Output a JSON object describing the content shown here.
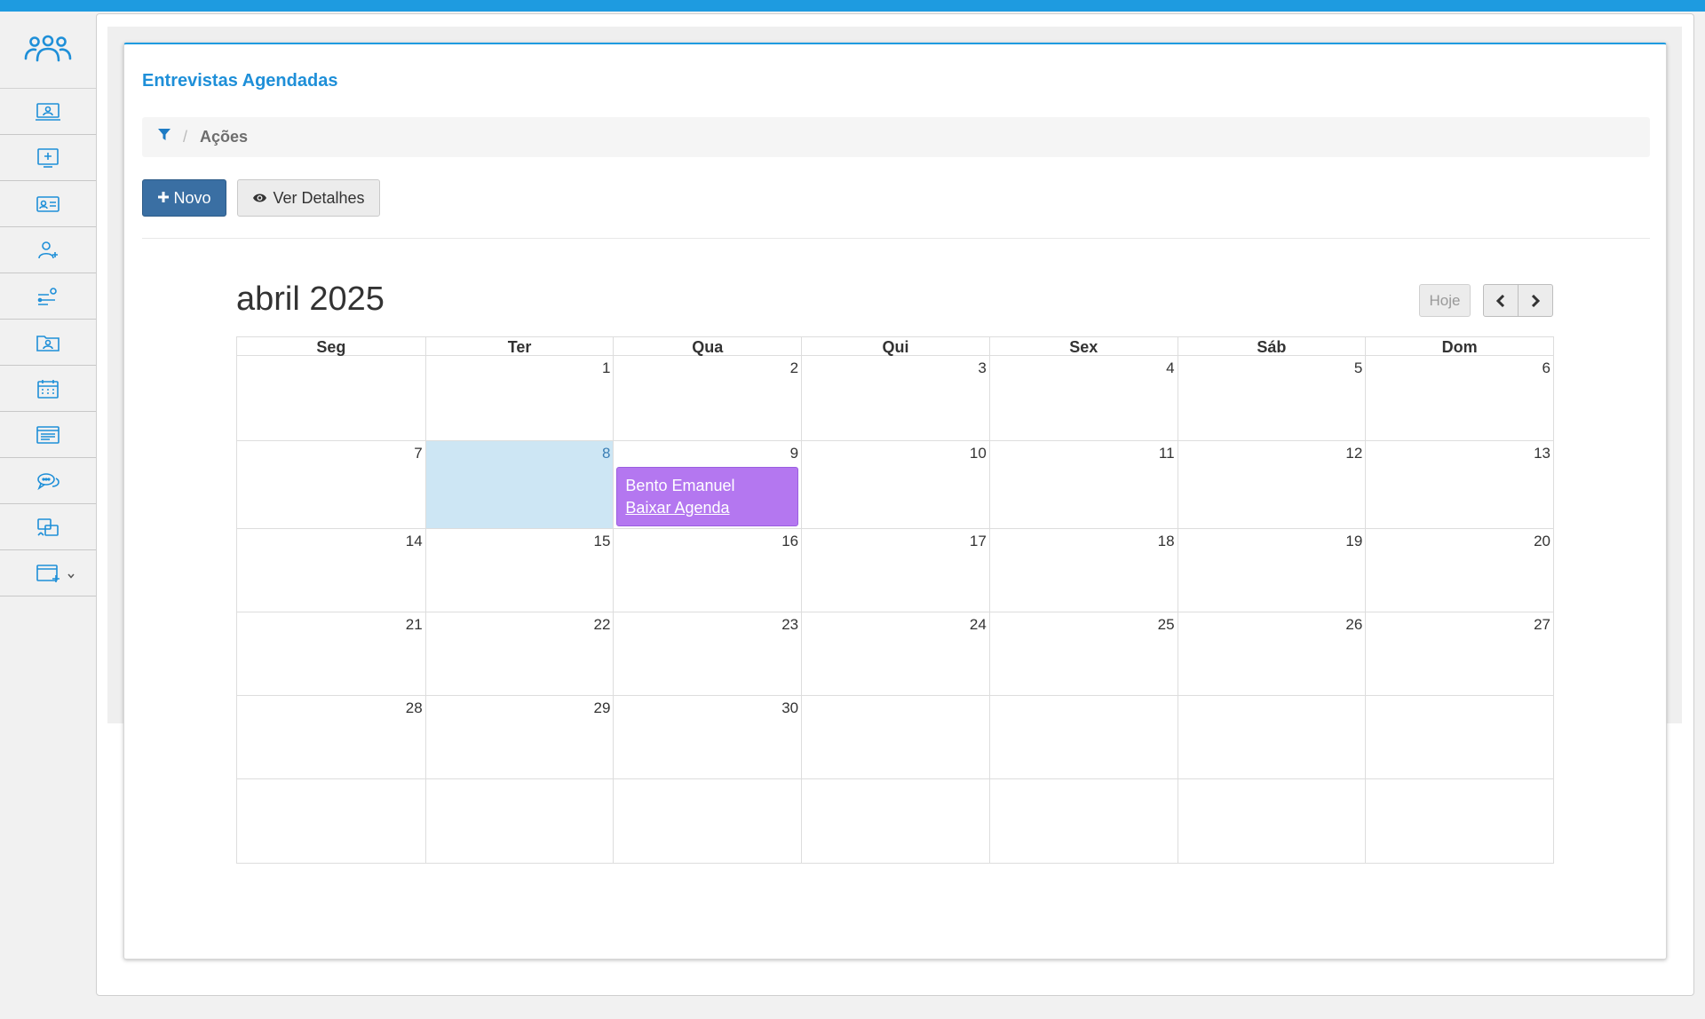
{
  "sidebar": {
    "logo_icon": "people-group-icon",
    "items": [
      {
        "icon": "monitor-user-icon"
      },
      {
        "icon": "monitor-add-icon"
      },
      {
        "icon": "id-card-icon"
      },
      {
        "icon": "user-add-icon"
      },
      {
        "icon": "user-route-icon"
      },
      {
        "icon": "folder-user-icon"
      },
      {
        "icon": "calendar-icon"
      },
      {
        "icon": "list-window-icon"
      },
      {
        "icon": "chat-bubbles-icon"
      },
      {
        "icon": "exchange-icon"
      },
      {
        "icon": "window-add-icon",
        "has_dropdown": true
      }
    ],
    "accent_color": "#1e8fd8"
  },
  "page": {
    "title": "Entrevistas Agendadas",
    "breadcrumb": {
      "icon": "filter-icon",
      "current": "Ações"
    },
    "buttons": {
      "novo": "Novo",
      "ver_detalhes": "Ver Detalhes"
    }
  },
  "calendar": {
    "title": "abril 2025",
    "today_button": "Hoje",
    "weekdays": [
      "Seg",
      "Ter",
      "Qua",
      "Qui",
      "Sex",
      "Sáb",
      "Dom"
    ],
    "weeks": [
      [
        "",
        "1",
        "2",
        "3",
        "4",
        "5",
        "6"
      ],
      [
        "7",
        "8",
        "9",
        "10",
        "11",
        "12",
        "13"
      ],
      [
        "14",
        "15",
        "16",
        "17",
        "18",
        "19",
        "20"
      ],
      [
        "21",
        "22",
        "23",
        "24",
        "25",
        "26",
        "27"
      ],
      [
        "28",
        "29",
        "30",
        "",
        "",
        "",
        ""
      ],
      [
        "",
        "",
        "",
        "",
        "",
        "",
        ""
      ]
    ],
    "today": "8",
    "event": {
      "day": "9",
      "name": "Bento Emanuel",
      "link": "Baixar Agenda",
      "color": "#b477f0"
    }
  }
}
